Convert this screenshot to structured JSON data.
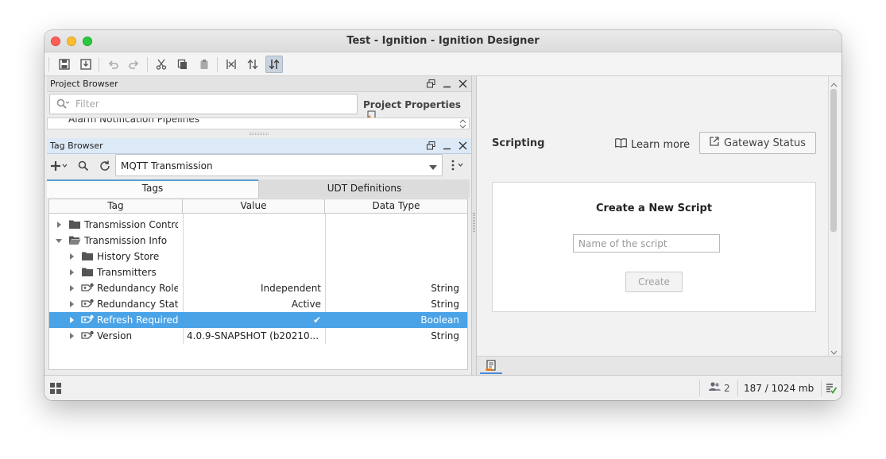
{
  "window": {
    "title": "Test - Ignition - Ignition Designer"
  },
  "toolbar": {
    "buttons": [
      "save-icon",
      "save-all-icon",
      "undo-icon",
      "redo-icon",
      "cut-icon",
      "copy-icon",
      "paste-icon",
      "align-icon",
      "distribute-icon",
      "dock-icon"
    ]
  },
  "project_browser": {
    "title": "Project Browser",
    "filter_placeholder": "Filter",
    "properties_label": "Project Properties",
    "partial_item": "Alarm Notification Pipelines"
  },
  "tag_browser": {
    "title": "Tag Browser",
    "provider": "MQTT Transmission",
    "tabs": [
      "Tags",
      "UDT Definitions"
    ],
    "columns": [
      "Tag",
      "Value",
      "Data Type"
    ],
    "rows": [
      {
        "indent": 0,
        "expander": "right",
        "icon": "folder-icon",
        "tag": "Transmission Control",
        "value": "",
        "type": "",
        "selected": false
      },
      {
        "indent": 0,
        "expander": "down",
        "icon": "folder-open-icon",
        "tag": "Transmission Info",
        "value": "",
        "type": "",
        "selected": false
      },
      {
        "indent": 1,
        "expander": "right",
        "icon": "folder-icon",
        "tag": "History Store",
        "value": "",
        "type": "",
        "selected": false
      },
      {
        "indent": 1,
        "expander": "right",
        "icon": "folder-icon",
        "tag": "Transmitters",
        "value": "",
        "type": "",
        "selected": false
      },
      {
        "indent": 1,
        "expander": "right",
        "icon": "tag-icon",
        "tag": "Redundancy Role",
        "value": "Independent",
        "type": "String",
        "selected": false
      },
      {
        "indent": 1,
        "expander": "right",
        "icon": "tag-icon",
        "tag": "Redundancy State",
        "value": "Active",
        "type": "String",
        "selected": false
      },
      {
        "indent": 1,
        "expander": "right",
        "icon": "tag-icon",
        "tag": "Refresh Required",
        "value": "✔",
        "type": "Boolean",
        "selected": true
      },
      {
        "indent": 1,
        "expander": "right",
        "icon": "tag-icon",
        "tag": "Version",
        "value": "4.0.9-SNAPSHOT (b20210...",
        "type": "String",
        "selected": false,
        "value_align": "left"
      }
    ]
  },
  "scripting": {
    "title": "Scripting",
    "learn_more": "Learn more",
    "gateway_status": "Gateway Status",
    "create_title": "Create a New Script",
    "name_placeholder": "Name of the script",
    "create_button": "Create"
  },
  "status": {
    "users": "2",
    "memory": "187 / 1024 mb"
  },
  "colors": {
    "selection": "#4aa3e7",
    "tab_accent": "#5b9bd5",
    "active_header": "#dce9f6"
  }
}
